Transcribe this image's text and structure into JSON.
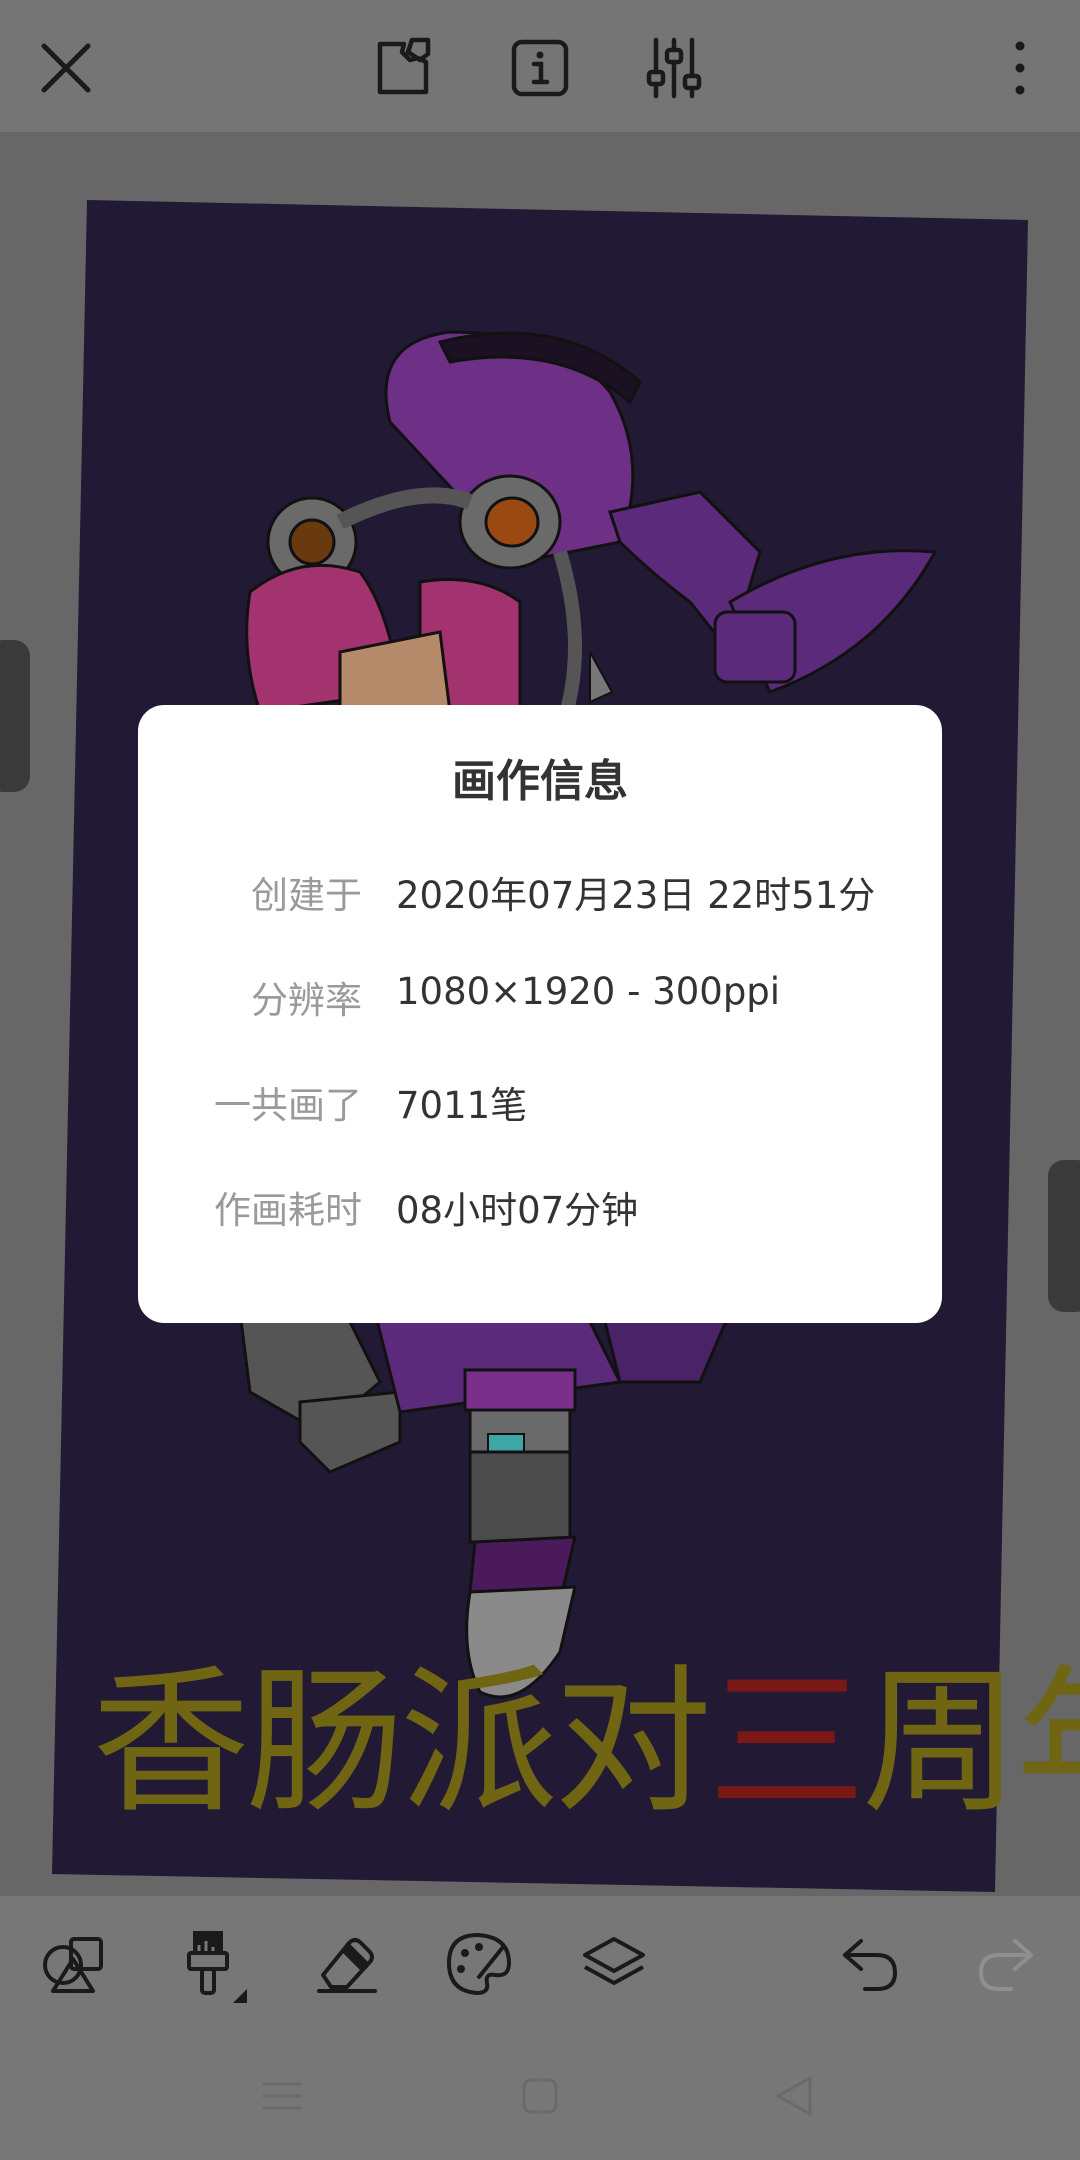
{
  "topbar": {
    "icons": [
      "close-icon",
      "canvas-crop-icon",
      "info-icon",
      "adjust-sliders-icon",
      "more-vertical-icon"
    ]
  },
  "artwork": {
    "caption_main": "香肠派对",
    "caption_accent": "三",
    "caption_end": "周年"
  },
  "dialog": {
    "title": "画作信息",
    "rows": [
      {
        "label": "创建于",
        "value": "2020年07月23日 22时51分"
      },
      {
        "label": "分辨率",
        "value": "1080×1920 - 300ppi"
      },
      {
        "label": "一共画了",
        "value": "7011笔"
      },
      {
        "label": "作画耗时",
        "value": "08小时07分钟"
      }
    ]
  },
  "toolbar": {
    "tools": [
      "shapes-icon",
      "brush-icon",
      "eraser-icon",
      "palette-icon",
      "layers-icon",
      "undo-icon",
      "redo-icon"
    ]
  },
  "navbar": {
    "buttons": [
      "menu-icon",
      "home-icon",
      "back-icon"
    ]
  },
  "colors": {
    "topbar_bg": "#757575",
    "canvas_bg": "#676767",
    "artwork_bg": "#221934",
    "caption": "#6f6512",
    "caption_accent": "#7a1818",
    "dialog_bg": "#ffffff"
  }
}
